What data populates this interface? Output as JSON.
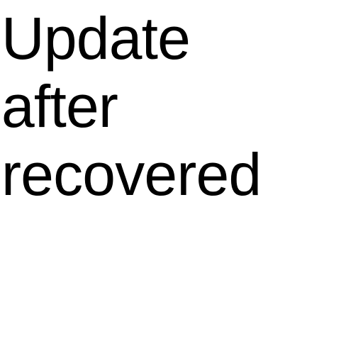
{
  "message": {
    "lines": [
      "Update",
      "after",
      "recovered"
    ]
  },
  "colors": {
    "background": "#ffffff",
    "text": "#000000"
  }
}
